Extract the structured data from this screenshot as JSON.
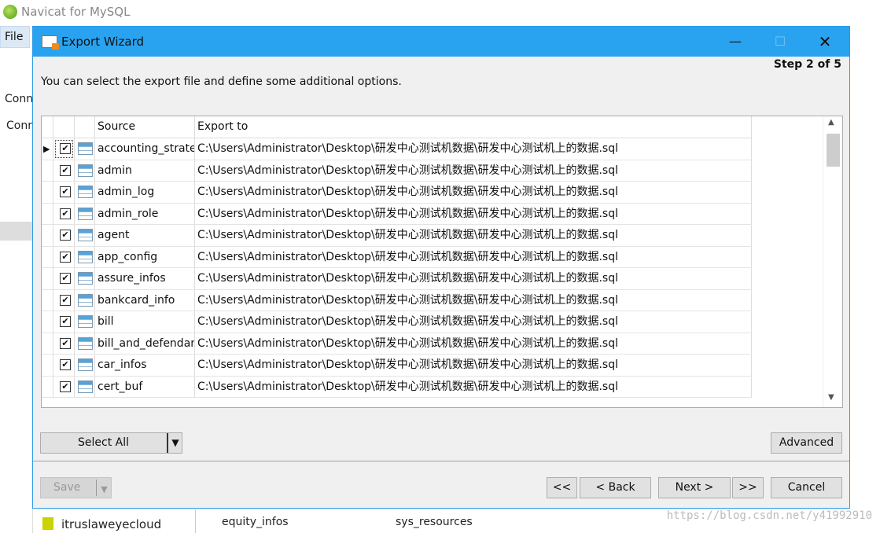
{
  "app": {
    "title": "Navicat for MySQL",
    "menu_file": "File",
    "conn_label1": "Conn",
    "conn_label2": "Conn",
    "tree_item": "itruslaweyecloud",
    "bg_tables": [
      "equity_infos",
      "sys_resources"
    ]
  },
  "dialog": {
    "title": "Export Wizard",
    "step": "Step 2 of 5",
    "description": "You can select the export file and define some additional options.",
    "columns": {
      "source": "Source",
      "export_to": "Export to"
    },
    "rows": [
      {
        "source": "accounting_strategy",
        "export_to": "C:\\Users\\Administrator\\Desktop\\研发中心测试机数据\\研发中心测试机上的数据.sql",
        "checked": true,
        "current": true
      },
      {
        "source": "admin",
        "export_to": "C:\\Users\\Administrator\\Desktop\\研发中心测试机数据\\研发中心测试机上的数据.sql",
        "checked": true
      },
      {
        "source": "admin_log",
        "export_to": "C:\\Users\\Administrator\\Desktop\\研发中心测试机数据\\研发中心测试机上的数据.sql",
        "checked": true
      },
      {
        "source": "admin_role",
        "export_to": "C:\\Users\\Administrator\\Desktop\\研发中心测试机数据\\研发中心测试机上的数据.sql",
        "checked": true
      },
      {
        "source": "agent",
        "export_to": "C:\\Users\\Administrator\\Desktop\\研发中心测试机数据\\研发中心测试机上的数据.sql",
        "checked": true
      },
      {
        "source": "app_config",
        "export_to": "C:\\Users\\Administrator\\Desktop\\研发中心测试机数据\\研发中心测试机上的数据.sql",
        "checked": true
      },
      {
        "source": "assure_infos",
        "export_to": "C:\\Users\\Administrator\\Desktop\\研发中心测试机数据\\研发中心测试机上的数据.sql",
        "checked": true
      },
      {
        "source": "bankcard_info",
        "export_to": "C:\\Users\\Administrator\\Desktop\\研发中心测试机数据\\研发中心测试机上的数据.sql",
        "checked": true
      },
      {
        "source": "bill",
        "export_to": "C:\\Users\\Administrator\\Desktop\\研发中心测试机数据\\研发中心测试机上的数据.sql",
        "checked": true
      },
      {
        "source": "bill_and_defendant",
        "export_to": "C:\\Users\\Administrator\\Desktop\\研发中心测试机数据\\研发中心测试机上的数据.sql",
        "checked": true
      },
      {
        "source": "car_infos",
        "export_to": "C:\\Users\\Administrator\\Desktop\\研发中心测试机数据\\研发中心测试机上的数据.sql",
        "checked": true
      },
      {
        "source": "cert_buf",
        "export_to": "C:\\Users\\Administrator\\Desktop\\研发中心测试机数据\\研发中心测试机上的数据.sql",
        "checked": true
      }
    ],
    "buttons": {
      "select_all": "Select All",
      "advanced": "Advanced",
      "save": "Save",
      "first": "<<",
      "back": "< Back",
      "next": "Next >",
      "last": ">>",
      "cancel": "Cancel"
    }
  },
  "watermark": "https://blog.csdn.net/y41992910",
  "colors": {
    "titlebar": "#29a3ef"
  }
}
